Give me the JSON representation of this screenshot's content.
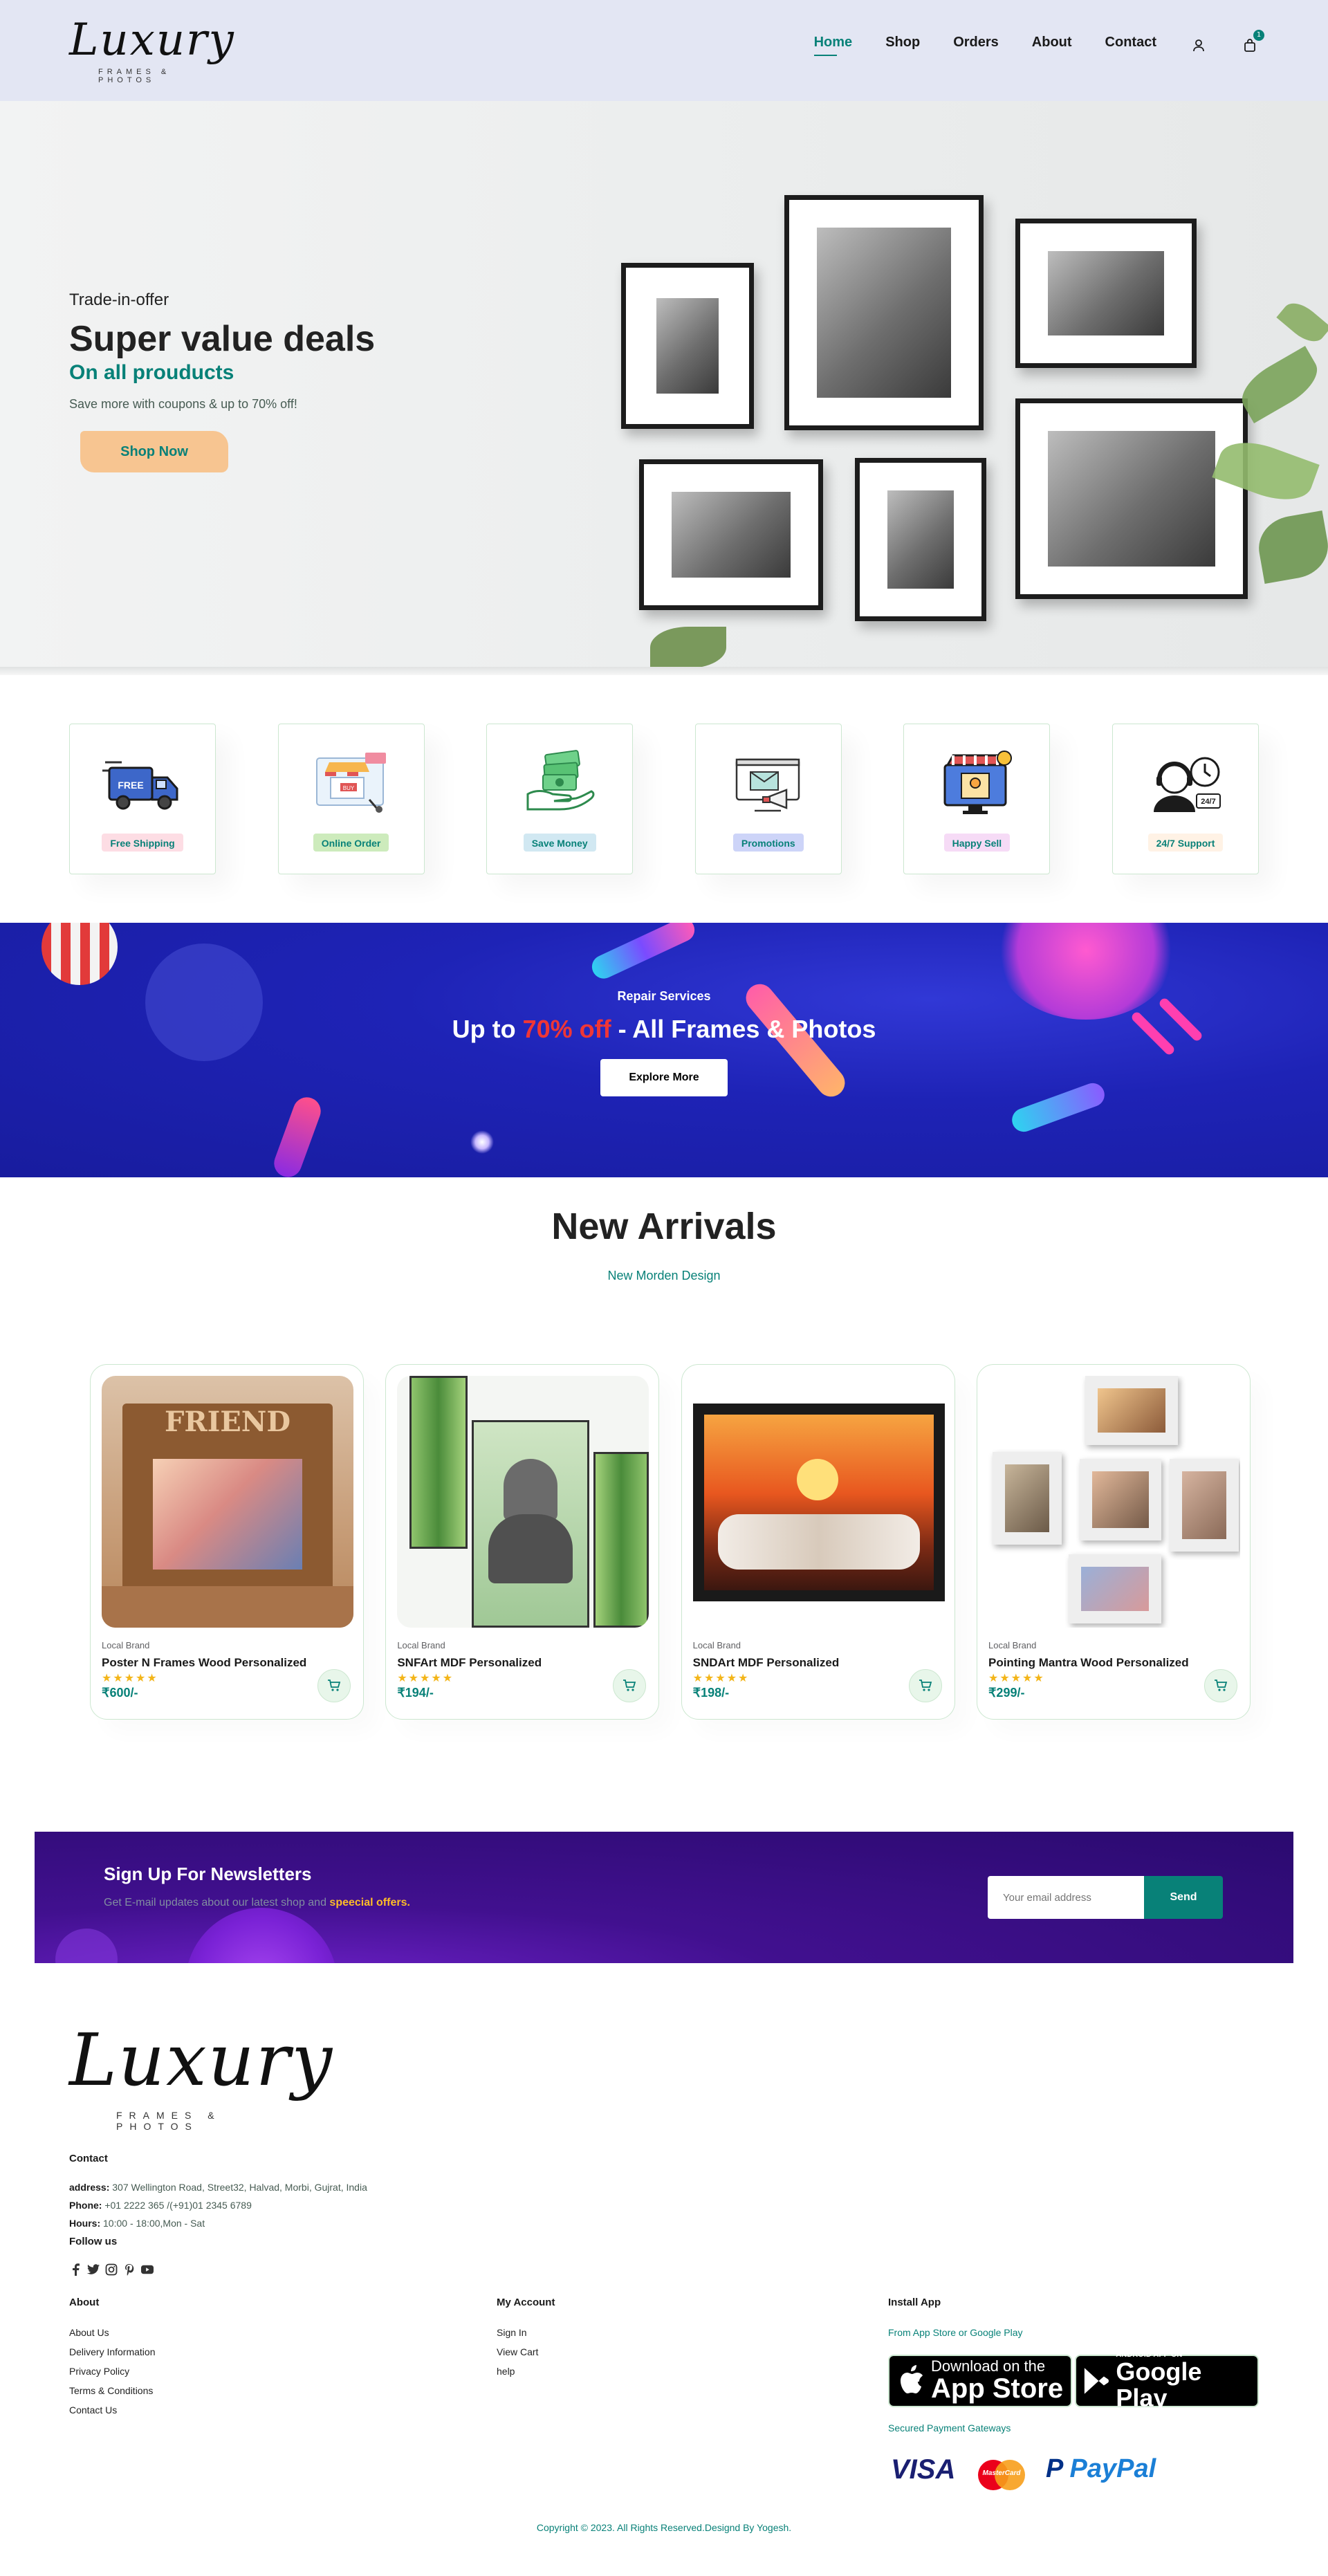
{
  "header": {
    "logo_text": "Luxury",
    "logo_sub": "FRAMES & PHOTOS",
    "nav": [
      "Home",
      "Shop",
      "Orders",
      "About",
      "Contact"
    ],
    "active_nav": "Home",
    "cart_count": "1",
    "icons": [
      "user-icon",
      "shopping-bag-icon"
    ]
  },
  "hero": {
    "kicker": "Trade-in-offer",
    "title": "Super value deals",
    "subtitle": "On all prouducts",
    "text": "Save more with coupons & up to 70% off!",
    "button": "Shop Now"
  },
  "features": [
    {
      "label": "Free Shipping",
      "icon": "truck-icon",
      "bg": "#fddde4"
    },
    {
      "label": "Online Order",
      "icon": "online-store-icon",
      "bg": "#cdebbc"
    },
    {
      "label": "Save Money",
      "icon": "money-hand-icon",
      "bg": "#d1e8f2"
    },
    {
      "label": "Promotions",
      "icon": "megaphone-icon",
      "bg": "#cdd4f8"
    },
    {
      "label": "Happy Sell",
      "icon": "shop-screen-icon",
      "bg": "#f6dbf6"
    },
    {
      "label": "24/7 Support",
      "icon": "support-clock-icon",
      "bg": "#fff2e5"
    }
  ],
  "banner": {
    "kicker": "Repair Services",
    "title_prefix": "Up to ",
    "title_highlight": "70% off",
    "title_suffix": " - All Frames & Photos",
    "button": "Explore More"
  },
  "arrivals": {
    "title": "New Arrivals",
    "subtitle": "New Morden Design",
    "products": [
      {
        "brand": "Local Brand",
        "name": "Poster N Frames Wood Personalized",
        "price": "₹600/-",
        "stars": "★★★★★",
        "image": "friends-frame"
      },
      {
        "brand": "Local Brand",
        "name": "SNFArt MDF Personalized",
        "price": "₹194/-",
        "stars": "★★★★★",
        "image": "buddha-bamboo"
      },
      {
        "brand": "Local Brand",
        "name": "SNDArt MDF Personalized",
        "price": "₹198/-",
        "stars": "★★★★★",
        "image": "horses-sunset"
      },
      {
        "brand": "Local Brand",
        "name": "Pointing Mantra Wood Personalized",
        "price": "₹299/-",
        "stars": "★★★★★",
        "image": "photo-collage"
      }
    ]
  },
  "newsletter": {
    "title": "Sign Up For Newsletters",
    "text_prefix": "Get E-mail updates about our latest shop and ",
    "text_highlight": "speecial offers.",
    "placeholder": "Your email address",
    "button": "Send"
  },
  "footer": {
    "logo_text": "Luxury",
    "logo_sub": "FRAMES & PHOTOS",
    "contact_title": "Contact",
    "address_label": "address:",
    "address": "307 Wellington Road, Street32, Halvad, Morbi, Gujrat, India",
    "phone_label": "Phone:",
    "phone": "+01 2222 365 /(+91)01 2345 6789",
    "hours_label": "Hours:",
    "hours": "10:00 - 18:00,Mon - Sat",
    "follow_title": "Follow us",
    "about_title": "About",
    "about_links": [
      "About Us",
      "Delivery Information",
      "Privacy Policy",
      "Terms & Conditions",
      "Contact Us"
    ],
    "account_title": "My Account",
    "account_links": [
      "Sign In",
      "View Cart",
      "help"
    ],
    "app_title": "Install App",
    "app_text": "From App Store or Google Play",
    "appstore_small": "Download on the",
    "appstore_big": "App Store",
    "gplay_small": "ANDROID APP ON",
    "gplay_big": "Google Play",
    "payment_text": "Secured Payment Gateways",
    "payments": [
      "VISA",
      "MasterCard",
      "PayPal"
    ],
    "copyright": "Copyright © 2023. All Rights Reserved.Designd By Yogesh."
  },
  "colors": {
    "accent": "#088178",
    "header_bg": "#e3e6f3",
    "hero_button": "#f7c591",
    "banner_bg": "#1e23b6",
    "banner_highlight": "#ef3636",
    "newsletter_bg": "#41108f",
    "newsletter_highlight": "#ffbd27",
    "stars": "#f3b519"
  }
}
